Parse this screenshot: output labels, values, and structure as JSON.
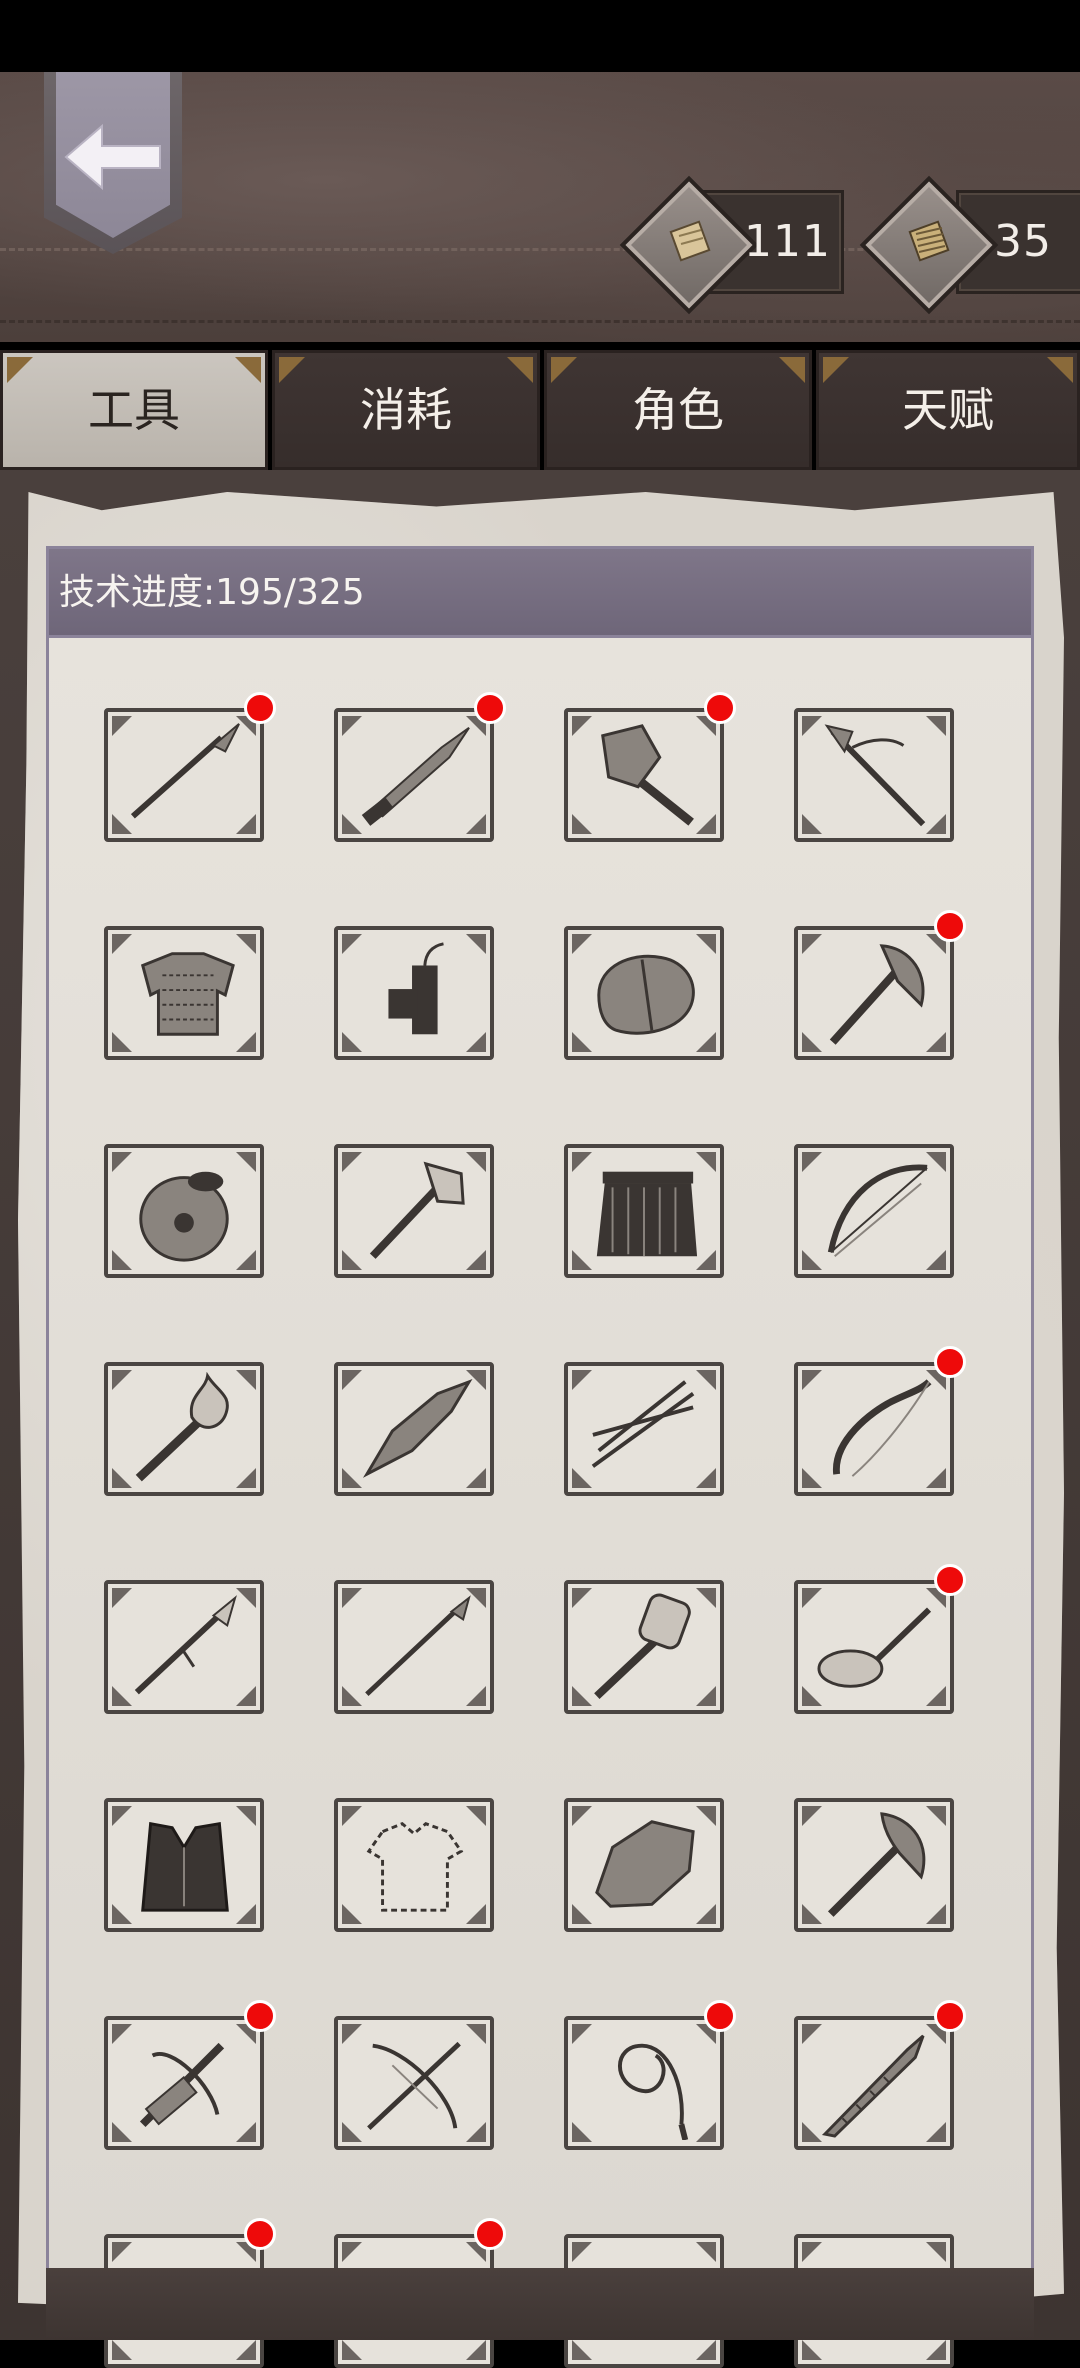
{
  "header": {
    "back_button": "back-arrow-icon",
    "currencies": [
      {
        "icon": "fabric-scroll-icon",
        "value": "111"
      },
      {
        "icon": "woven-cloth-icon",
        "value": "35"
      }
    ]
  },
  "tabs": [
    {
      "label": "工具",
      "active": true
    },
    {
      "label": "消耗",
      "active": false
    },
    {
      "label": "角色",
      "active": false
    },
    {
      "label": "天赋",
      "active": false
    }
  ],
  "progress": {
    "label": "技术进度:195/325",
    "current": 195,
    "total": 325
  },
  "items": [
    {
      "icon": "spear-icon",
      "new": true
    },
    {
      "icon": "dagger-icon",
      "new": true
    },
    {
      "icon": "stone-hammer-icon",
      "new": true
    },
    {
      "icon": "staff-spear-icon",
      "new": false
    },
    {
      "icon": "chainmail-armor-icon",
      "new": false
    },
    {
      "icon": "dynamite-icon",
      "new": false
    },
    {
      "icon": "armor-backpack-icon",
      "new": false
    },
    {
      "icon": "battle-axe-icon",
      "new": true
    },
    {
      "icon": "poison-pot-icon",
      "new": false
    },
    {
      "icon": "stone-axe-icon",
      "new": false
    },
    {
      "icon": "grass-skirt-icon",
      "new": false
    },
    {
      "icon": "bow-icon",
      "new": false
    },
    {
      "icon": "fire-torch-icon",
      "new": false
    },
    {
      "icon": "flint-blade-icon",
      "new": false
    },
    {
      "icon": "arrows-icon",
      "new": false
    },
    {
      "icon": "recurve-bow-icon",
      "new": true
    },
    {
      "icon": "tribal-spear-icon",
      "new": false
    },
    {
      "icon": "long-spear-icon",
      "new": false
    },
    {
      "icon": "war-hammer-icon",
      "new": false
    },
    {
      "icon": "frying-pan-icon",
      "new": true
    },
    {
      "icon": "leather-vest-icon",
      "new": false
    },
    {
      "icon": "locked-shirt-outline-icon",
      "new": false
    },
    {
      "icon": "stone-chunk-icon",
      "new": false
    },
    {
      "icon": "double-axe-icon",
      "new": false
    },
    {
      "icon": "crossbow-icon",
      "new": true
    },
    {
      "icon": "heavy-crossbow-icon",
      "new": false
    },
    {
      "icon": "whip-icon",
      "new": true
    },
    {
      "icon": "serrated-sword-icon",
      "new": true
    },
    {
      "icon": "partial-item-icon",
      "new": true
    },
    {
      "icon": "partial-item-icon",
      "new": true
    },
    {
      "icon": "partial-item-icon",
      "new": false
    },
    {
      "icon": "partial-item-icon",
      "new": false
    }
  ]
}
